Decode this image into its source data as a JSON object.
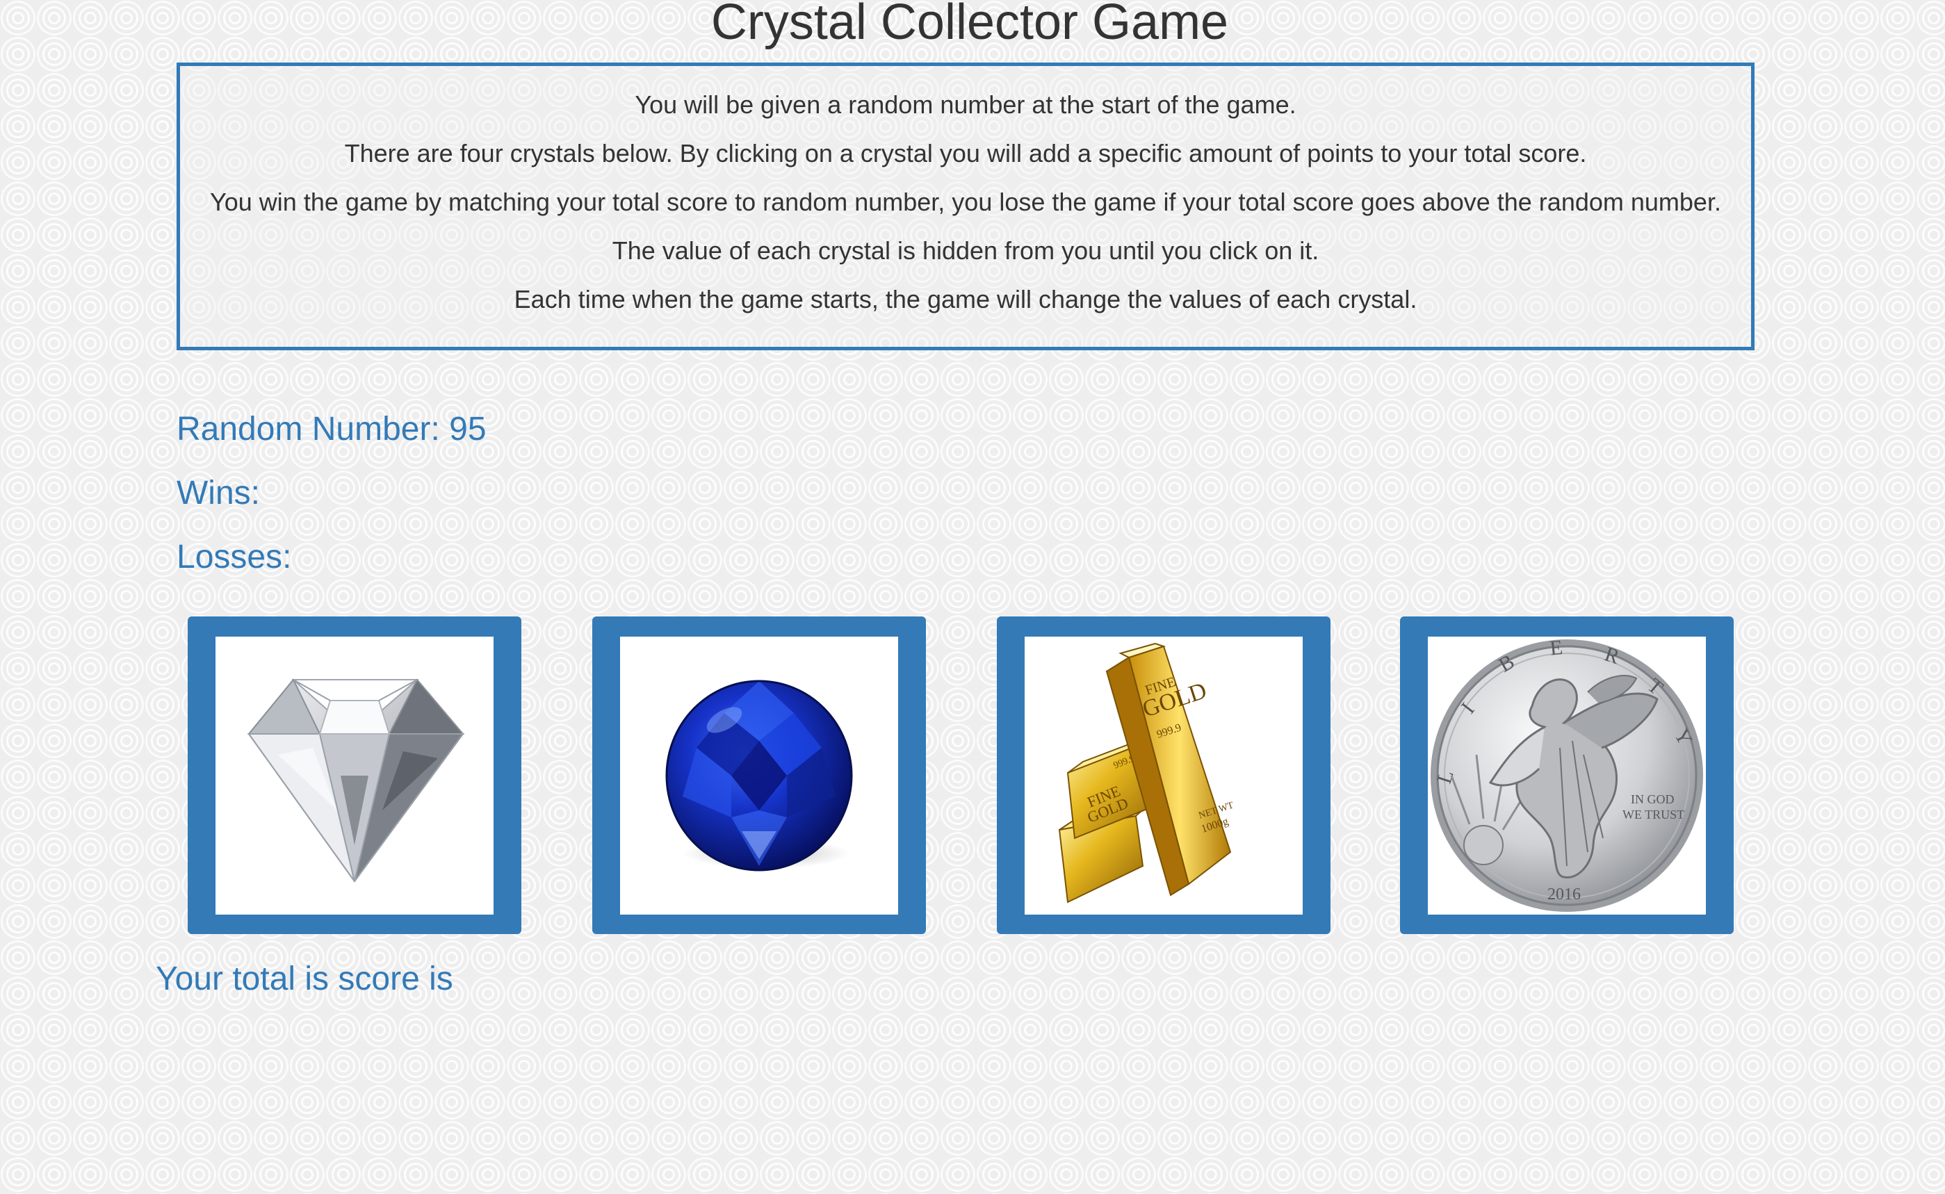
{
  "header": {
    "title": "Crystal Collector Game"
  },
  "instructions": [
    "You will be given a random number at the start of the game.",
    "There are four crystals below. By clicking on a crystal you will add a specific amount of points to your total score.",
    "You win the game by matching your total score to random number, you lose the game if your total score goes above the random number.",
    "The value of each crystal is hidden from you until you click on it.",
    "Each time when the game starts, the game will change the values of each crystal."
  ],
  "stats": {
    "random_number": "Random Number: 95",
    "wins": "Wins:",
    "losses": "Losses:"
  },
  "crystals": [
    {
      "icon": "diamond-icon"
    },
    {
      "icon": "sapphire-icon"
    },
    {
      "icon": "gold-bars-icon"
    },
    {
      "icon": "silver-coin-icon"
    }
  ],
  "coin_text": {
    "letters": [
      "L",
      "I",
      "B",
      "E",
      "R",
      "T",
      "Y"
    ],
    "motto_line1": "IN GOD",
    "motto_line2": "WE TRUST",
    "year": "2016"
  },
  "gold_text": {
    "big_bar_line1": "FINE",
    "big_bar_line2": "GOLD",
    "big_bar_purity": "999.9",
    "big_bar_weight1": "NET WT",
    "big_bar_weight2": "1000g",
    "small_bar_line1": "FINE",
    "small_bar_line2": "GOLD",
    "small_bar_purity": "999.9"
  },
  "score": {
    "label": "Your total is score is"
  },
  "colors": {
    "accent": "#337ab7",
    "text": "#333333",
    "background": "#eeeeef"
  }
}
